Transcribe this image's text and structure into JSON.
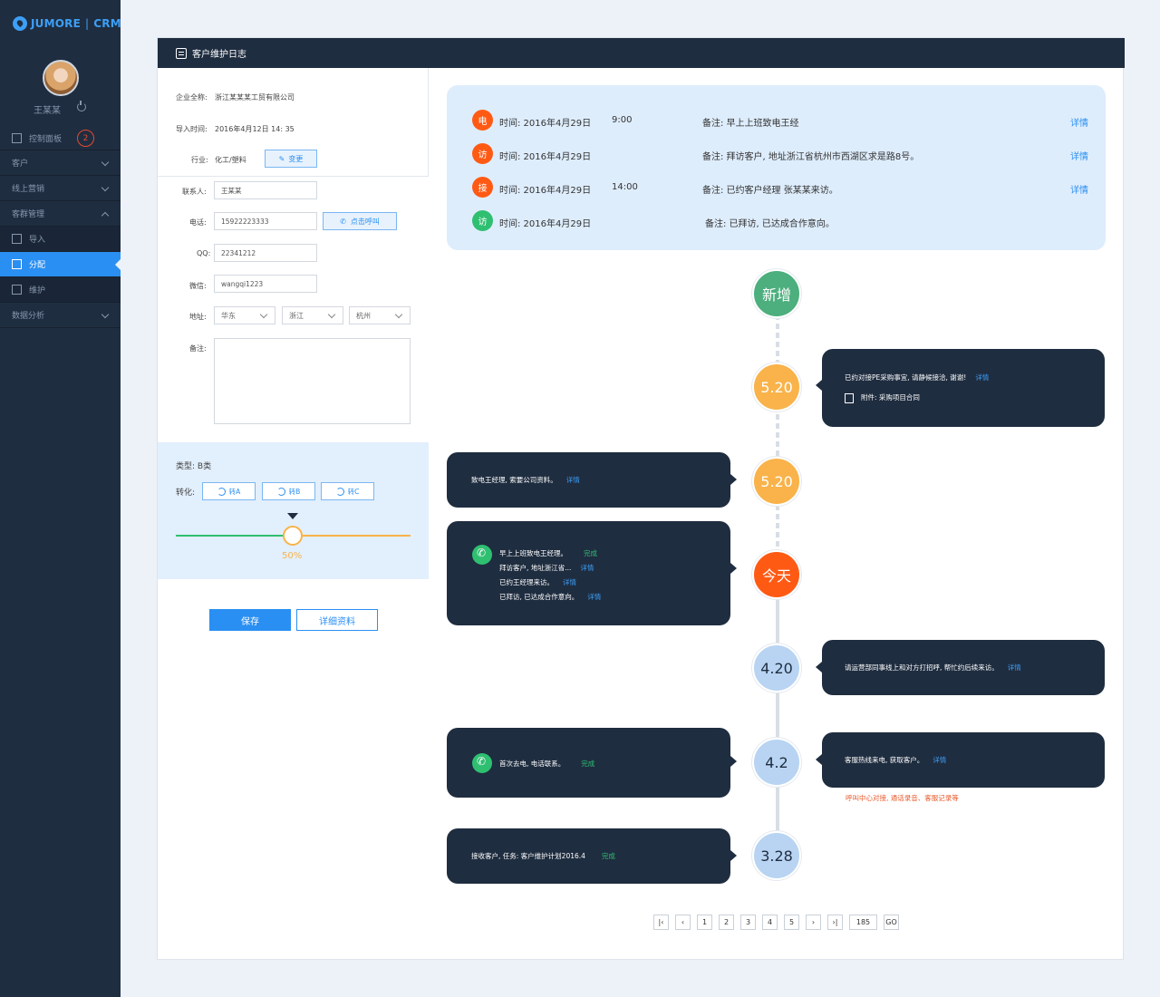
{
  "brand": {
    "name": "JUMORE",
    "product": "CRM"
  },
  "user": {
    "name": "王某某"
  },
  "nav": {
    "dashboard": "控制面板",
    "badge": "2",
    "customers": "客户",
    "online_marketing": "线上营销",
    "group_mgmt": "客群管理",
    "import": "导入",
    "assign": "分配",
    "maintain": "维护",
    "analytics": "数据分析"
  },
  "panel": {
    "title": "客户维护日志"
  },
  "form": {
    "company_label": "企业全称:",
    "company_value": "浙江某某某工贸有限公司",
    "import_label": "导入时间:",
    "import_value": "2016年4月12日   14: 35",
    "industry_label": "行业:",
    "industry_value": "化工/塑料",
    "change_btn": "变更",
    "contact_label": "联系人:",
    "contact_value": "王某某",
    "phone_label": "电话:",
    "phone_value": "15922223333",
    "call_btn": "点击呼叫",
    "qq_label": "QQ:",
    "qq_value": "22341212",
    "wechat_label": "微信:",
    "wechat_value": "wangqi1223",
    "address_label": "地址:",
    "region": "华东",
    "province": "浙江",
    "city": "杭州",
    "remark_label": "备注:",
    "type_label": "类型: ",
    "type_value": "B类",
    "convert_label": "转化:",
    "to_a": "转A",
    "to_b": "转B",
    "to_c": "转C",
    "progress": "50%",
    "save_btn": "保存",
    "detail_btn": "详细资料"
  },
  "summary": [
    {
      "icon": "电",
      "color": "#ff5a14",
      "time": "时间: 2016年4月29日",
      "hour": "9:00",
      "note": "备注: 早上上班致电王经",
      "link": "详情"
    },
    {
      "icon": "访",
      "color": "#ff5a14",
      "time": "时间: 2016年4月29日",
      "hour": "",
      "note": "备注: 拜访客户, 地址浙江省杭州市西湖区求是路8号。",
      "link": "详情"
    },
    {
      "icon": "接",
      "color": "#ff5a14",
      "time": "时间: 2016年4月29日",
      "hour": "14:00",
      "note": "备注: 已约客户经理 张某某来访。",
      "link": "详情"
    },
    {
      "icon": "访",
      "color": "#2fbf71",
      "time": "时间: 2016年4月29日",
      "hour": "",
      "note": "备注: 已拜访, 已达成合作意向。",
      "link": ""
    }
  ],
  "timeline": {
    "nodes": [
      "新增",
      "5.20",
      "5.20",
      "今天",
      "4.20",
      "4.2",
      "3.28"
    ],
    "colors": {
      "new": "#4caf7d",
      "orange": "#f9b34a",
      "today": "#ff5a14",
      "past": "#b8d4f2"
    },
    "b1": {
      "text": "已约对接PE采购事宜, 请静候接洽, 谢谢!",
      "link": "详情",
      "attach": "附件: 采购项目合同"
    },
    "b2": {
      "text": "致电王经理, 索要公司资料。",
      "link": "详情"
    },
    "b3": {
      "l1": "早上上班致电王经理。",
      "s1": "完成",
      "l2": "拜访客户, 地址浙江省...",
      "s2": "详情",
      "l3": "已约王经理来访。",
      "s3": "详情",
      "l4": "已拜访, 已达成合作意向。",
      "s4": "详情"
    },
    "b4": {
      "text": "请运营部同事线上和对方打招呼, 帮忙约后续来访。",
      "link": "详情"
    },
    "b5": {
      "text": "首次去电, 电话联系。",
      "status": "完成"
    },
    "b6": {
      "text": "客服热线来电, 获取客户。",
      "link": "详情"
    },
    "b6_note": "呼叫中心对接, 通话录音、客服记录等",
    "b7": {
      "text": "接收客户, 任务: 客户维护计划2016.4",
      "status": "完成"
    }
  },
  "pager": {
    "pages": [
      "1",
      "2",
      "3",
      "4",
      "5"
    ],
    "total": "185",
    "go": "GO"
  }
}
